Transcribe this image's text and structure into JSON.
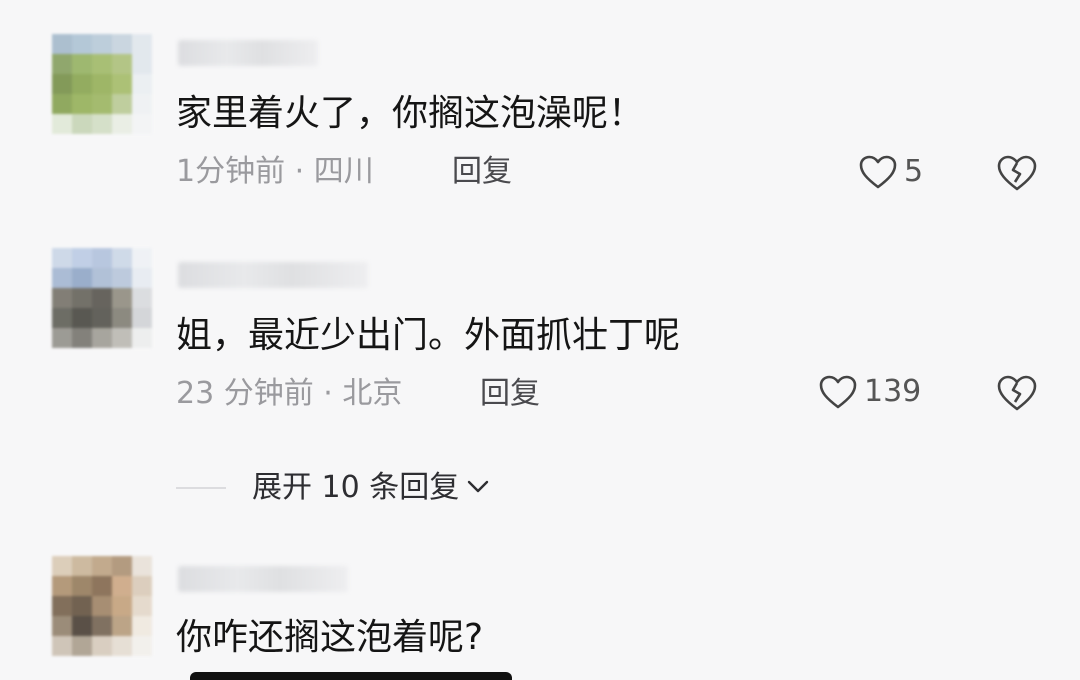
{
  "comments": [
    {
      "text": "家里着火了，你搁这泡澡呢！",
      "meta": "1分钟前 · 四川",
      "reply_label": "回复",
      "likes": "5",
      "avatar_colors": [
        "#9fb6c9",
        "#a9c0d2",
        "#b4c7d6",
        "#c3d1dc",
        "#dfe6ec",
        "#7f9a55",
        "#8fae59",
        "#9bb65f",
        "#a8bd73",
        "#dfe6ec",
        "#6f8a3e",
        "#82a046",
        "#8fab4e",
        "#a0b860",
        "#e9eef2",
        "#7f9c46",
        "#8fac4f",
        "#96b158",
        "#b6c78f",
        "#eef1f3",
        "#dfe8d5",
        "#c4d3b2",
        "#d0dcc1",
        "#e8ede2",
        "#f3f4f5"
      ]
    },
    {
      "text": "姐，最近少出门。外面抓壮丁呢",
      "meta": "23 分钟前 · 北京",
      "reply_label": "回复",
      "likes": "139",
      "avatar_colors": [
        "#c7d4e6",
        "#b8c9e3",
        "#aebfdb",
        "#c9d5e6",
        "#eef1f5",
        "#9eb2cf",
        "#8aa2c4",
        "#a5b8d2",
        "#b3c3d9",
        "#e6ebf1",
        "#6e6a60",
        "#5d5a51",
        "#4e4b44",
        "#8a8678",
        "#d7d9dc",
        "#55554c",
        "#3e3d36",
        "#4a4941",
        "#7a776c",
        "#cfd1d4",
        "#8d8b84",
        "#6f6d66",
        "#9a978f",
        "#b7b5ae",
        "#eceded"
      ]
    },
    {
      "text": "你咋还搁这泡着呢?",
      "avatar_colors": [
        "#d8c7b0",
        "#c6b091",
        "#b99d7b",
        "#a88b6c",
        "#e8e0d6",
        "#a98a66",
        "#8f7452",
        "#7c5f43",
        "#caa27c",
        "#d8c8b4",
        "#6e5840",
        "#5b4935",
        "#9a7c5c",
        "#c09c74",
        "#e3d6c6",
        "#8c7a63",
        "#3f3429",
        "#6c5a47",
        "#b29674",
        "#efe8de",
        "#c9bdae",
        "#a59886",
        "#d4c8b8",
        "#e4dbcf",
        "#f2efeb"
      ]
    }
  ],
  "expand_replies": "展开 10 条回复"
}
